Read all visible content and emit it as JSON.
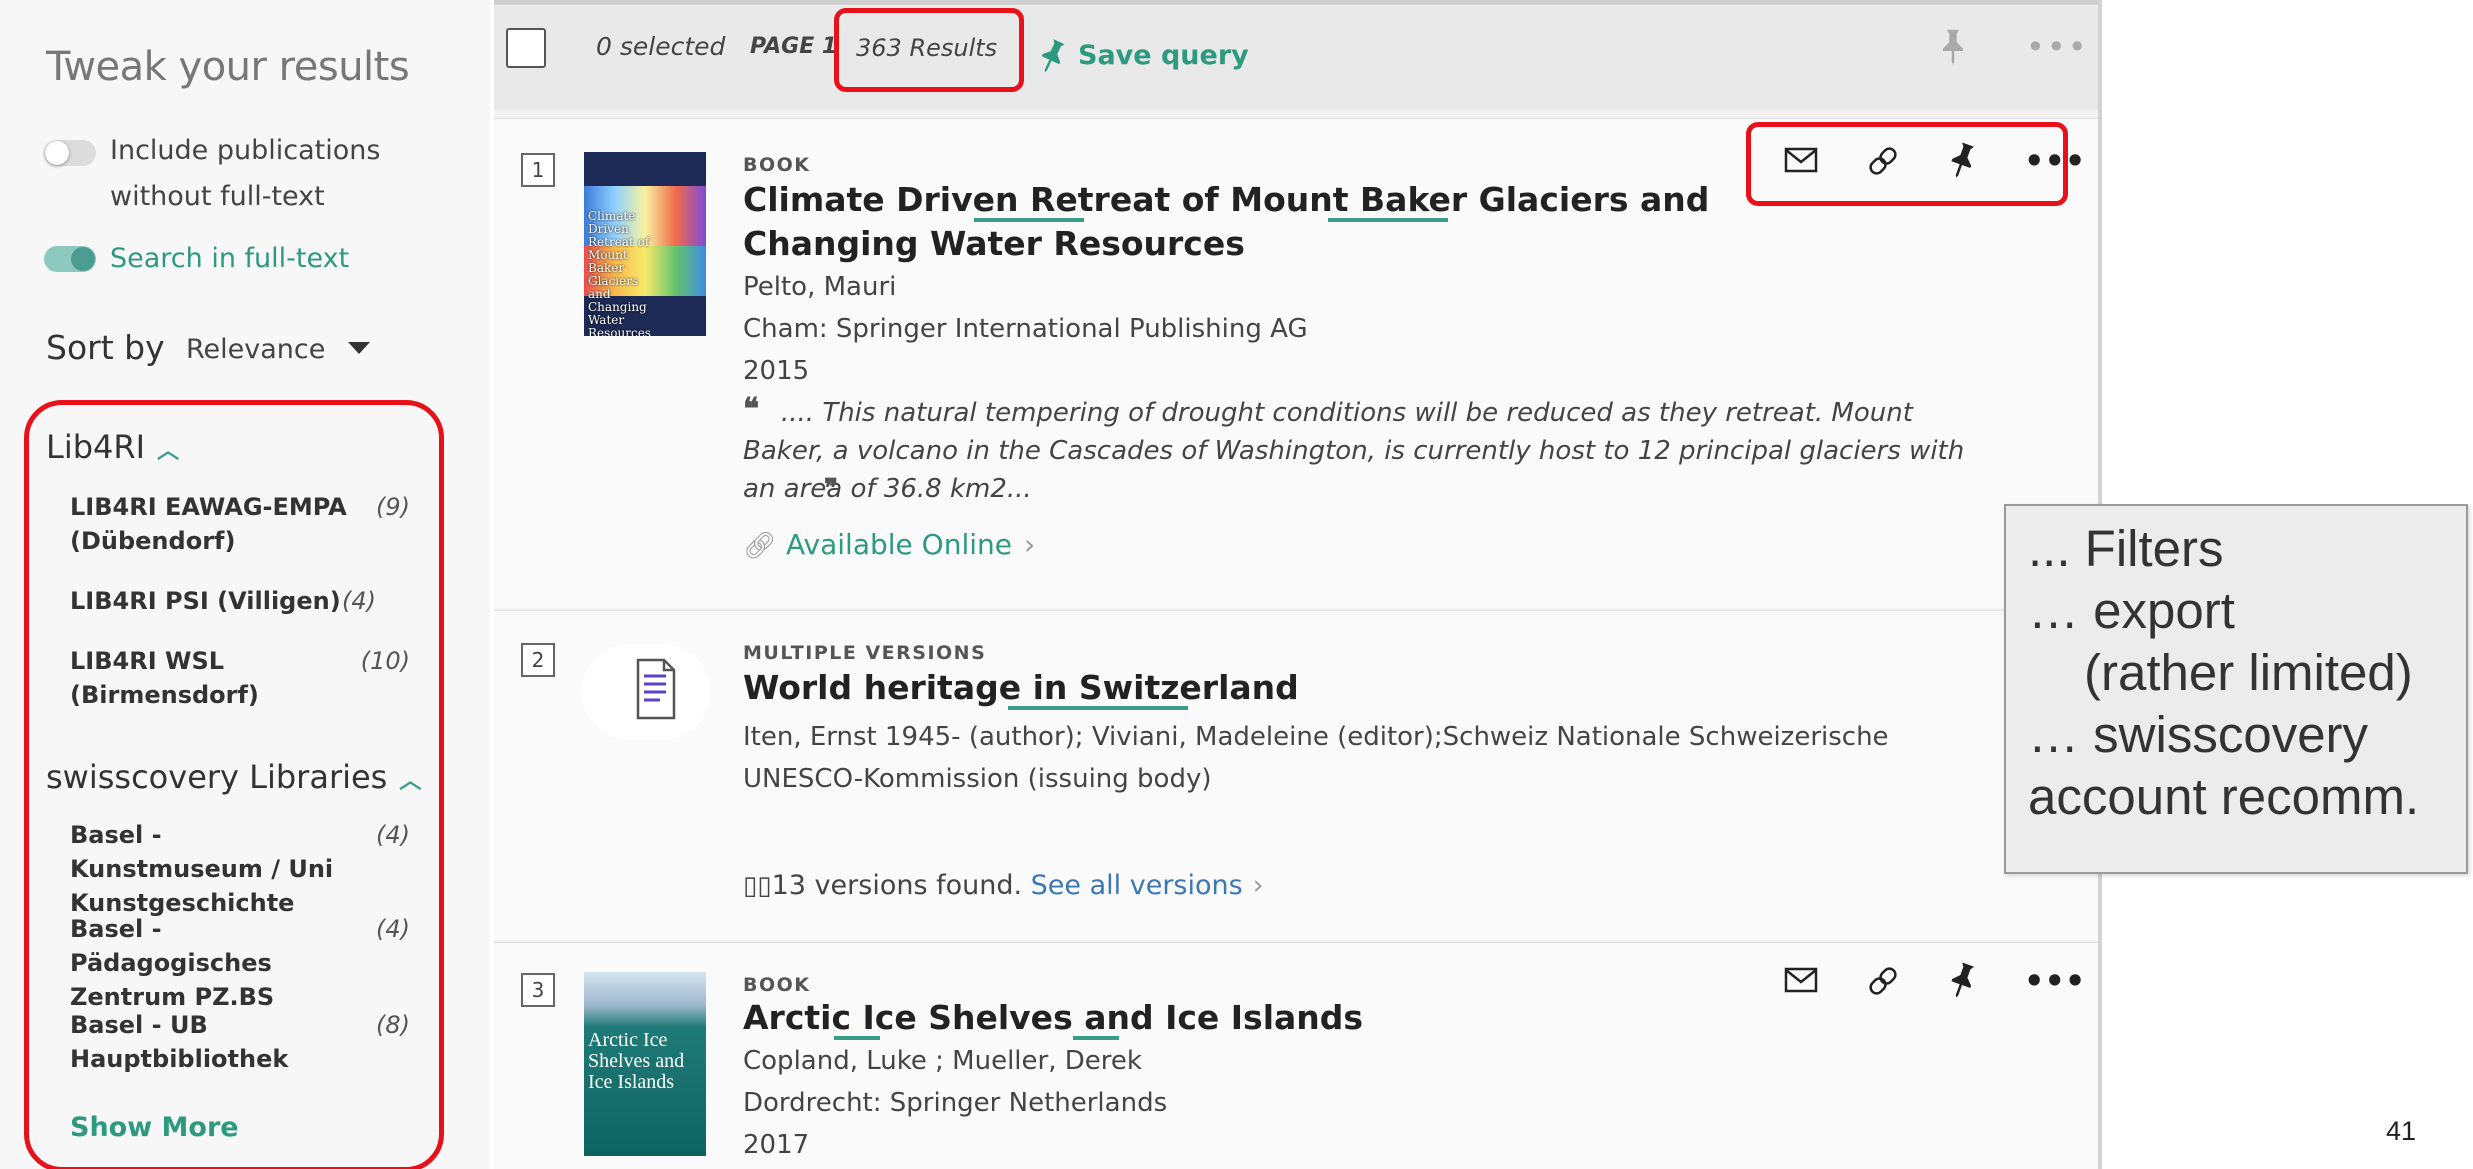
{
  "sidebar": {
    "title": "Tweak your results",
    "include_without_fulltext": "Include publications without full-text",
    "search_in_fulltext": "Search in full-text",
    "sort_by_label": "Sort by",
    "sort_by_value": "Relevance",
    "facets": [
      {
        "group": "Lib4RI",
        "items": [
          {
            "name": "LIB4RI EAWAG-EMPA (Dübendorf)",
            "count": "(9)"
          },
          {
            "name": "LIB4RI PSI (Villigen)",
            "count": "(4)"
          },
          {
            "name": "LIB4RI WSL (Birmensdorf)",
            "count": "(10)"
          }
        ]
      },
      {
        "group": "swisscovery Libraries",
        "items": [
          {
            "name": "Basel - Kunstmuseum / Uni Kunstgeschichte",
            "count": "(4)"
          },
          {
            "name": "Basel - Pädagogisches Zentrum PZ.BS",
            "count": "(4)"
          },
          {
            "name": "Basel - UB Hauptbibliothek",
            "count": "(8)"
          }
        ]
      }
    ],
    "show_more": "Show More"
  },
  "toolbar": {
    "selected": "0 selected",
    "page": "PAGE 1",
    "results": "363 Results",
    "save_query": "Save query"
  },
  "results": [
    {
      "number": "1",
      "type": "BOOK",
      "title": "Climate Driven Retreat of Mount Baker Glaciers and Changing Water Resources",
      "authors": "Pelto, Mauri",
      "publisher": "Cham: Springer International Publishing AG",
      "year": "2015",
      "snippet": ".... This natural tempering of drought conditions will be reduced as they retreat. Mount Baker, a volcano in the Cascades of Washington, is currently host to 12 principal glaciers with an area of 36.8 km2...",
      "availability": "Available Online",
      "cover_text": "Climate Driven Retreat of Mount Baker Glaciers and Changing Water Resources"
    },
    {
      "number": "2",
      "type": "MULTIPLE VERSIONS",
      "title": "World heritage in Switzerland",
      "authors": "Iten, Ernst 1945- (author); Viviani, Madeleine (editor);Schweiz Nationale Schweizerische UNESCO-Kommission (issuing body)",
      "versions_text": "13 versions found.",
      "versions_link": "See all versions"
    },
    {
      "number": "3",
      "type": "BOOK",
      "title": "Arctic Ice Shelves and Ice Islands",
      "authors": "Copland, Luke ; Mueller, Derek",
      "publisher": "Dordrecht: Springer Netherlands",
      "year": "2017",
      "cover_text": "Arctic Ice Shelves and Ice Islands"
    }
  ],
  "annotation": {
    "lines": [
      "... Filters",
      "… export",
      "(rather limited)",
      "… swisscovery",
      "account recomm."
    ]
  },
  "page_number": "41",
  "colors": {
    "accent": "#2d9a7f",
    "highlight": "#e8111a",
    "link": "#3b77b5"
  }
}
